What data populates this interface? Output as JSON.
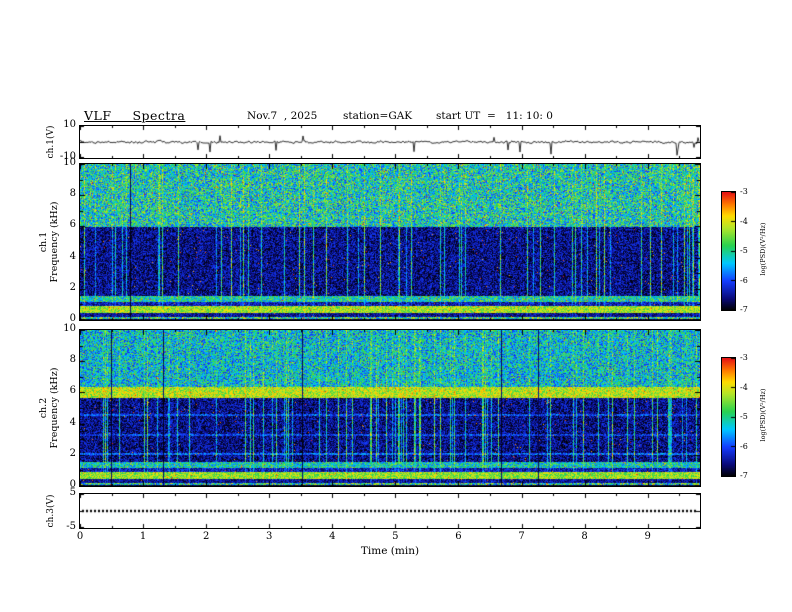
{
  "header": {
    "title": "VLF  Spectra",
    "date": "Nov.7  , 2025",
    "station": "station=GAK",
    "start_ut": "start UT  =   11: 10: 0"
  },
  "chart_data": {
    "type": "heatmap",
    "title": "VLF Spectra",
    "subtitle": "Nov.7 , 2025   station=GAK   start UT = 11:10:0",
    "grid": false,
    "x": {
      "label": "Time (min)",
      "range": [
        0,
        9.83
      ],
      "ticks": [
        0,
        1,
        2,
        3,
        4,
        5,
        6,
        7,
        8,
        9
      ]
    },
    "colorbar": {
      "label": "log(PSD)(V²/Hz)",
      "range_log10": [
        -7,
        -3
      ],
      "ticks": [
        -3,
        -4,
        -5,
        -6,
        -7
      ]
    },
    "palette": {
      "stops": [
        [
          0,
          "#000000"
        ],
        [
          0.1,
          "#0a0a78"
        ],
        [
          0.25,
          "#143cff"
        ],
        [
          0.4,
          "#00c8ff"
        ],
        [
          0.55,
          "#28d250"
        ],
        [
          0.7,
          "#b4e628"
        ],
        [
          0.8,
          "#ffdc00"
        ],
        [
          0.9,
          "#ff7800"
        ],
        [
          1,
          "#e61414"
        ]
      ]
    },
    "panels": [
      {
        "id": "ch1-waveform",
        "type": "line",
        "ylabel": "ch.1(V)",
        "ylim": [
          -10,
          10
        ],
        "yticks": [
          10,
          -10
        ],
        "seed": 20251107,
        "noise_amp": 1.3,
        "neg_spike_prob": 0.015,
        "neg_spike_amp": [
          3,
          8
        ],
        "pos_spike_prob": 0.004,
        "pos_spike_amp": [
          2,
          5
        ],
        "description": "broadband receiver noise fluctuating around 0 V with intermittent sharp negative spikes"
      },
      {
        "id": "ch1-spectrogram",
        "type": "spectrogram",
        "ylabel": "ch.1 Frequency (kHz)",
        "ylabel_line1": "ch.1",
        "ylabel_line2": "Frequency (kHz)",
        "ylim": [
          0,
          10
        ],
        "yticks": [
          0,
          2,
          4,
          6,
          8,
          10
        ],
        "seed": 42,
        "streak_prob": 0.1,
        "dark_col_prob": 0.008,
        "bands": [
          {
            "f": [
              6,
              10.01
            ],
            "level": 0.46,
            "jitter": 0.24,
            "streak": 0.28,
            "speckle": 0.012
          },
          {
            "f": [
              1.6,
              6
            ],
            "level": 0.1,
            "jitter": 0.13,
            "streak": 0.85,
            "speckle": 0.004
          },
          {
            "f": [
              1.2,
              1.6
            ],
            "level": 0.48,
            "jitter": 0.2,
            "streak": 0.15,
            "speckle": 0.01
          },
          {
            "f": [
              0.9,
              1.2
            ],
            "level": 0.16,
            "jitter": 0.12,
            "streak": 0.3,
            "speckle": 0.004
          },
          {
            "f": [
              0.5,
              0.9
            ],
            "level": 0.68,
            "jitter": 0.14,
            "streak": 0.05,
            "speckle": 0.02
          },
          {
            "f": [
              0.25,
              0.5
            ],
            "level": 0.12,
            "jitter": 0.1,
            "streak": 0.2,
            "speckle": 0.004
          },
          {
            "f": [
              0.08,
              0.25
            ],
            "level": 0.52,
            "jitter": 0.28,
            "streak": 0.1,
            "speckle": 0.02
          },
          {
            "f": [
              0,
              0.08
            ],
            "level": 0.04,
            "jitter": 0.04,
            "streak": 0.0,
            "speckle": 0.0
          }
        ],
        "hlines": [],
        "description": "green/yellow broadband noise 6-10 kHz with scattered red bursts; dark blue 1.6-6 kHz crossed by dense vertical sferic streaks; bright horizontal bands near 0.6 and 1.4 kHz"
      },
      {
        "id": "ch2-spectrogram",
        "type": "spectrogram",
        "ylabel": "ch.2 Frequency (kHz)",
        "ylabel_line1": "ch.2",
        "ylabel_line2": "Frequency (kHz)",
        "ylim": [
          0,
          10
        ],
        "yticks": [
          0,
          2,
          4,
          6,
          8,
          10
        ],
        "seed": 1337,
        "streak_prob": 0.12,
        "dark_col_prob": 0.006,
        "bands": [
          {
            "f": [
              6.4,
              10.01
            ],
            "level": 0.42,
            "jitter": 0.22,
            "streak": 0.25,
            "speckle": 0.005
          },
          {
            "f": [
              5.7,
              6.4
            ],
            "level": 0.7,
            "jitter": 0.15,
            "streak": 0.1,
            "speckle": 0.012
          },
          {
            "f": [
              1.6,
              5.7
            ],
            "level": 0.1,
            "jitter": 0.13,
            "streak": 0.8,
            "speckle": 0.004
          },
          {
            "f": [
              1.2,
              1.6
            ],
            "level": 0.46,
            "jitter": 0.2,
            "streak": 0.15,
            "speckle": 0.008
          },
          {
            "f": [
              0.9,
              1.2
            ],
            "level": 0.16,
            "jitter": 0.12,
            "streak": 0.3,
            "speckle": 0.004
          },
          {
            "f": [
              0.5,
              0.9
            ],
            "level": 0.66,
            "jitter": 0.14,
            "streak": 0.05,
            "speckle": 0.016
          },
          {
            "f": [
              0.25,
              0.5
            ],
            "level": 0.12,
            "jitter": 0.1,
            "streak": 0.2,
            "speckle": 0.004
          },
          {
            "f": [
              0.08,
              0.25
            ],
            "level": 0.5,
            "jitter": 0.28,
            "streak": 0.1,
            "speckle": 0.016
          },
          {
            "f": [
              0,
              0.08
            ],
            "level": 0.04,
            "jitter": 0.04,
            "streak": 0.0,
            "speckle": 0.0
          }
        ],
        "hlines": [
          {
            "f": 2.1,
            "w": 0.07,
            "boost": 0.22
          },
          {
            "f": 3.3,
            "w": 0.05,
            "boost": 0.15
          },
          {
            "f": 4.6,
            "w": 0.06,
            "boost": 0.18
          }
        ],
        "description": "strong yellow/orange horizontal band near 6 kHz; green noise above; blue region below with vertical sferic streaks and faint cyan horizontal lines"
      },
      {
        "id": "ch3-waveform",
        "type": "line",
        "ylabel": "ch.3(V)",
        "ylim": [
          -5,
          5
        ],
        "yticks": [
          5,
          -5
        ],
        "value": 0,
        "description": "constant 0 V signal drawn as a thick dotted black line"
      }
    ]
  }
}
